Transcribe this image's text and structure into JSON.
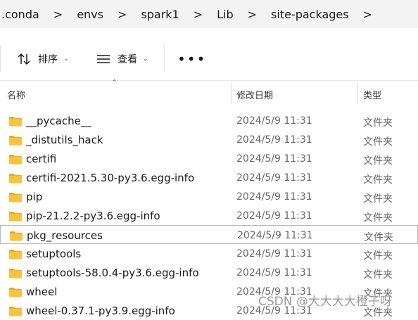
{
  "breadcrumb": {
    "items": [
      ".conda",
      "envs",
      "spark1",
      "Lib",
      "site-packages"
    ],
    "separator": ">"
  },
  "toolbar": {
    "sort_label": "排序",
    "view_label": "查看",
    "more_label": "•••"
  },
  "columns": {
    "name": "名称",
    "modified": "修改日期",
    "type": "类型"
  },
  "files": [
    {
      "name": "__pycache__",
      "modified": "2024/5/9 11:31",
      "type": "文件夹"
    },
    {
      "name": "_distutils_hack",
      "modified": "2024/5/9 11:31",
      "type": "文件夹"
    },
    {
      "name": "certifi",
      "modified": "2024/5/9 11:31",
      "type": "文件夹"
    },
    {
      "name": "certifi-2021.5.30-py3.6.egg-info",
      "modified": "2024/5/9 11:31",
      "type": "文件夹"
    },
    {
      "name": "pip",
      "modified": "2024/5/9 11:31",
      "type": "文件夹"
    },
    {
      "name": "pip-21.2.2-py3.6.egg-info",
      "modified": "2024/5/9 11:31",
      "type": "文件夹"
    },
    {
      "name": "pkg_resources",
      "modified": "2024/5/9 11:31",
      "type": "文件夹",
      "selected": true
    },
    {
      "name": "setuptools",
      "modified": "2024/5/9 11:31",
      "type": "文件夹"
    },
    {
      "name": "setuptools-58.0.4-py3.6.egg-info",
      "modified": "2024/5/9 11:31",
      "type": "文件夹"
    },
    {
      "name": "wheel",
      "modified": "2024/5/9 11:31",
      "type": "文件夹"
    },
    {
      "name": "wheel-0.37.1-py3.9.egg-info",
      "modified": "2024/5/9 11:31",
      "type": "文件夹"
    }
  ],
  "colors": {
    "folder": "#f8c33d",
    "folder_dark": "#e0a826",
    "selected_border": "#b8b8b8"
  },
  "watermark": "CSDN @大大大大橙子呀"
}
